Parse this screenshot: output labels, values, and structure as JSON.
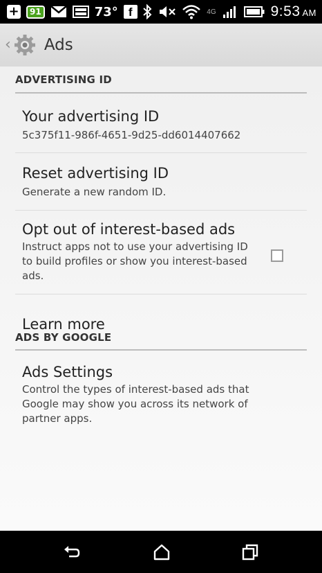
{
  "status_bar": {
    "notification_badge": "91",
    "temperature": "73°",
    "network_type": "4G",
    "time": "9:53",
    "ampm": "AM"
  },
  "action_bar": {
    "title": "Ads"
  },
  "sections": {
    "advertising_id": {
      "header": "ADVERTISING ID",
      "your_id": {
        "title": "Your advertising ID",
        "value": "5c375f11-986f-4651-9d25-dd6014407662"
      },
      "reset": {
        "title": "Reset advertising ID",
        "summary": "Generate a new random ID."
      },
      "opt_out": {
        "title": "Opt out of interest-based ads",
        "summary": "Instruct apps not to use your advertising ID to build profiles or show you interest-based ads.",
        "checked": false
      },
      "learn_more": {
        "title": "Learn more"
      }
    },
    "ads_by_google": {
      "header": "ADS BY GOOGLE",
      "ads_settings": {
        "title": "Ads Settings",
        "summary": "Control the types of interest-based ads that Google may show you across its network of partner apps."
      }
    }
  },
  "icons": {
    "status_left": [
      "plus-icon",
      "notification-badge-icon",
      "gmail-icon",
      "screenshot-icon",
      "facebook-icon"
    ],
    "status_right": [
      "bluetooth-icon",
      "mute-icon",
      "wifi-icon",
      "signal-icon",
      "battery-icon"
    ],
    "action_bar": [
      "back-caret-icon",
      "settings-gear-icon"
    ],
    "nav": [
      "back-icon",
      "home-icon",
      "recent-apps-icon"
    ]
  },
  "colors": {
    "status_bar_bg": "#000000",
    "action_bar_bg": "#dddddd",
    "content_bg": "#f3f3f3",
    "badge_green": "#4aa31d",
    "divider": "#bcbcbc"
  }
}
